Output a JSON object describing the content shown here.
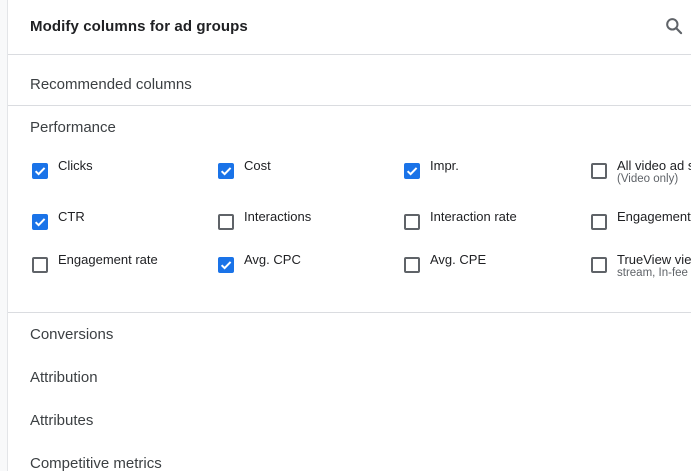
{
  "header": {
    "title": "Modify columns for ad groups",
    "search_icon": "search-icon"
  },
  "recommended": {
    "label": "Recommended columns"
  },
  "performance": {
    "title": "Performance",
    "items": [
      {
        "label": "Clicks",
        "checked": true,
        "sub": ""
      },
      {
        "label": "Cost",
        "checked": true,
        "sub": ""
      },
      {
        "label": "Impr.",
        "checked": true,
        "sub": ""
      },
      {
        "label": "All video ad s",
        "checked": false,
        "sub": "(Video only)"
      },
      {
        "label": "CTR",
        "checked": true,
        "sub": ""
      },
      {
        "label": "Interactions",
        "checked": false,
        "sub": ""
      },
      {
        "label": "Interaction rate",
        "checked": false,
        "sub": ""
      },
      {
        "label": "Engagements",
        "checked": false,
        "sub": ""
      },
      {
        "label": "Engagement rate",
        "checked": false,
        "sub": ""
      },
      {
        "label": "Avg. CPC",
        "checked": true,
        "sub": ""
      },
      {
        "label": "Avg. CPE",
        "checked": false,
        "sub": ""
      },
      {
        "label": "TrueView view",
        "checked": false,
        "sub": "stream, In-fee"
      }
    ]
  },
  "categories": [
    {
      "label": "Conversions"
    },
    {
      "label": "Attribution"
    },
    {
      "label": "Attributes"
    },
    {
      "label": "Competitive metrics"
    }
  ],
  "colors": {
    "checkbox_checked": "#1a73e8",
    "checkbox_unchecked_border": "#5f6368",
    "divider": "#dadce0"
  }
}
